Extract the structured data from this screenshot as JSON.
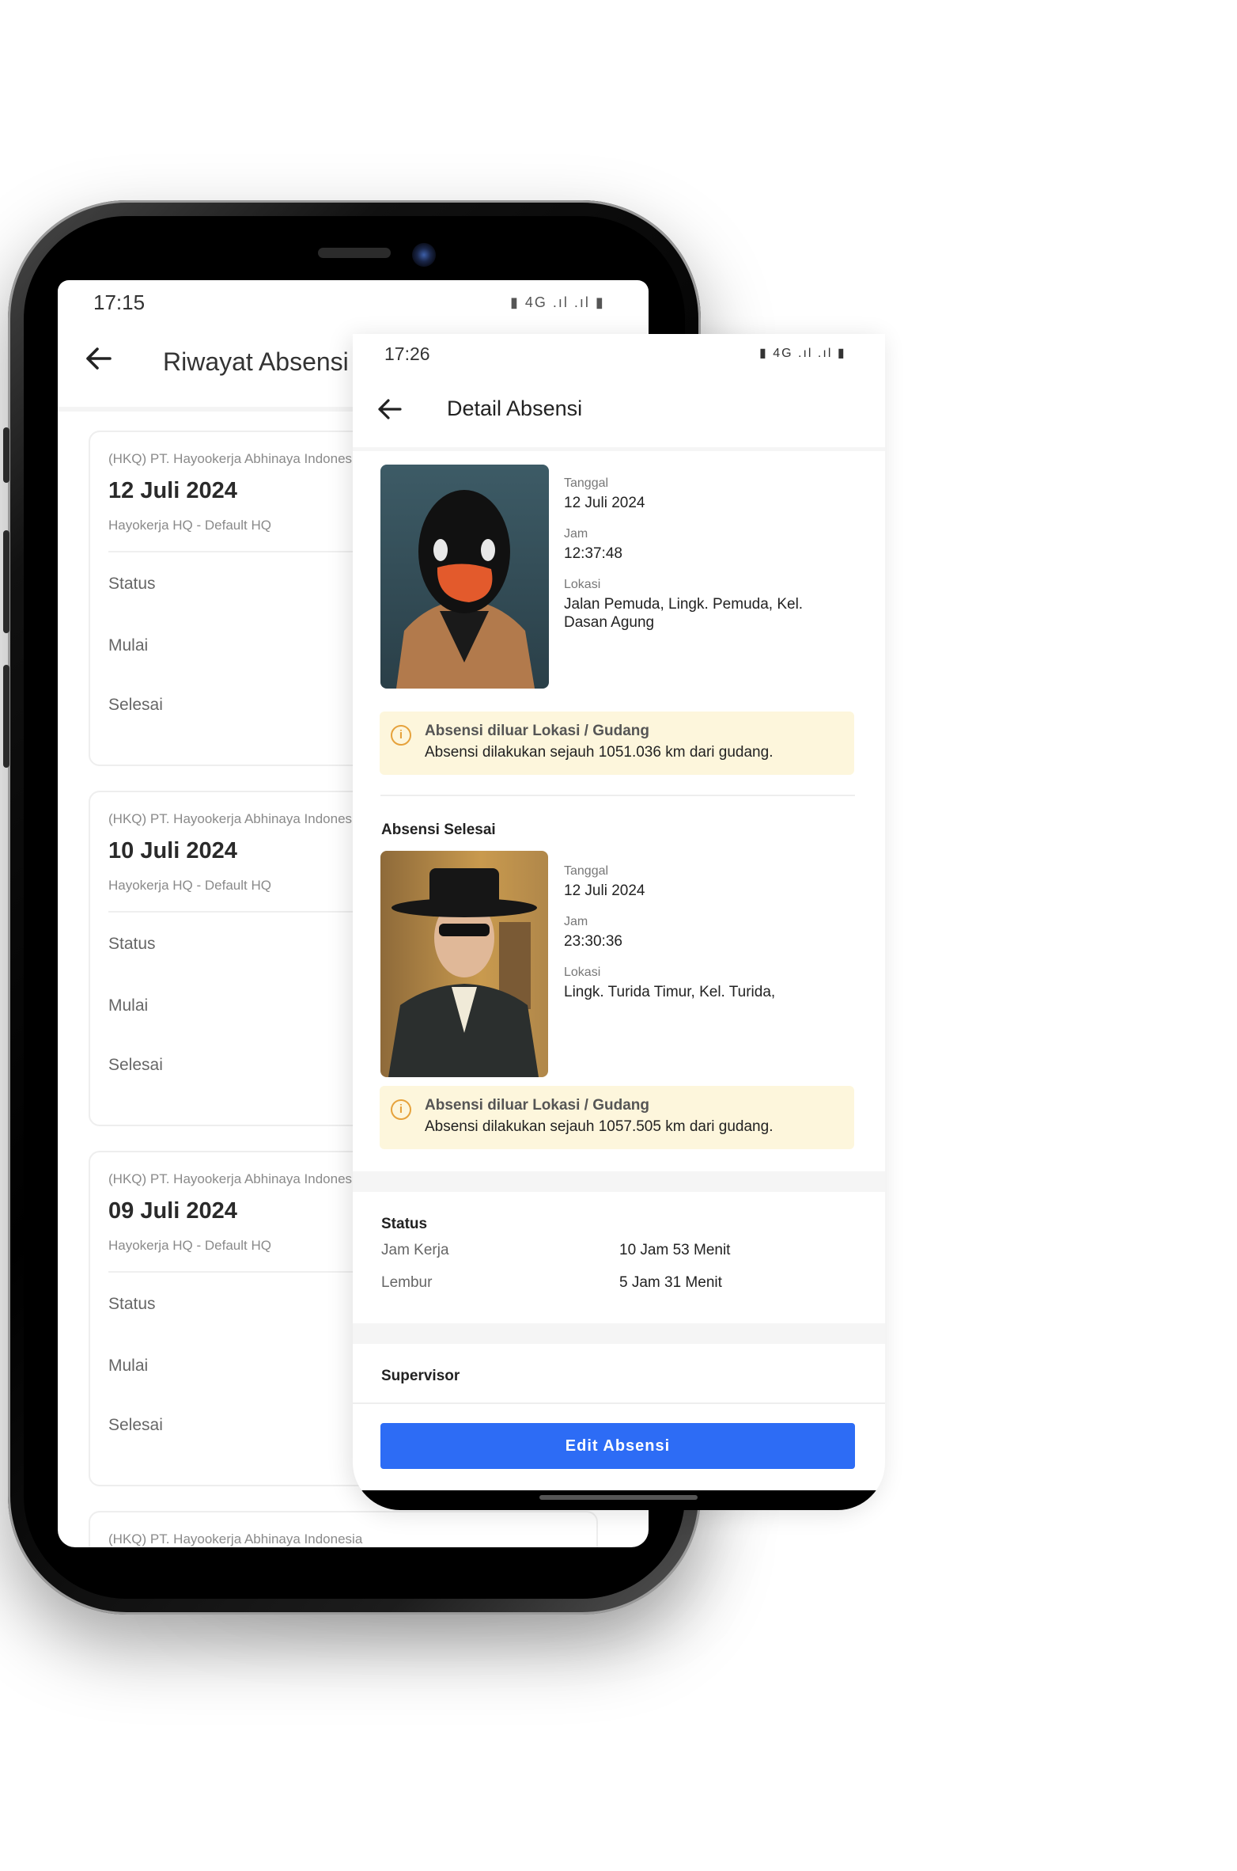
{
  "back_screen": {
    "time": "17:15",
    "status_icons": "▮ 4G .ıl .ıl ▮",
    "title": "Riwayat Absensi",
    "cards": [
      {
        "company": "(HKQ)  PT. Hayookerja Abhinaya Indonesia",
        "date": "12 Juli 2024",
        "location": "Hayokerja HQ - Default HQ",
        "status_label": "Status",
        "start_label": "Mulai",
        "end_label": "Selesai"
      },
      {
        "company": "(HKQ)  PT. Hayookerja Abhinaya Indonesia",
        "date": "10 Juli 2024",
        "location": "Hayokerja HQ - Default HQ",
        "status_label": "Status",
        "start_label": "Mulai",
        "end_label": "Selesai"
      },
      {
        "company": "(HKQ)  PT. Hayookerja Abhinaya Indonesia",
        "date": "09 Juli 2024",
        "location": "Hayokerja HQ - Default HQ",
        "status_label": "Status",
        "start_label": "Mulai",
        "end_label": "Selesai"
      },
      {
        "company": "(HKQ)  PT. Hayookerja Abhinaya Indonesia"
      }
    ]
  },
  "front_screen": {
    "time": "17:26",
    "status_icons": "▮ 4G .ıl .ıl ▮",
    "title": "Detail Absensi",
    "start_entry": {
      "date_label": "Tanggal",
      "date": "12 Juli 2024",
      "time_label": "Jam",
      "time": "12:37:48",
      "location_label": "Lokasi",
      "location": "Jalan Pemuda, Lingk. Pemuda, Kel. Dasan Agung",
      "warning_title": "Absensi diluar Lokasi / Gudang",
      "warning_text": "Absensi dilakukan sejauh 1051.036 km dari gudang."
    },
    "end_section_title": "Absensi Selesai",
    "end_entry": {
      "date_label": "Tanggal",
      "date": "12 Juli 2024",
      "time_label": "Jam",
      "time": "23:30:36",
      "location_label": "Lokasi",
      "location": "Lingk. Turida Timur, Kel. Turida,",
      "warning_title": "Absensi diluar Lokasi / Gudang",
      "warning_text": "Absensi dilakukan sejauh 1057.505 km dari gudang."
    },
    "status": {
      "title": "Status",
      "work_hours_label": "Jam Kerja",
      "work_hours": "10 Jam 53 Menit",
      "overtime_label": "Lembur",
      "overtime": "5 Jam 31 Menit"
    },
    "supervisor_title": "Supervisor",
    "edit_button": "Edit Absensi"
  },
  "colors": {
    "primary": "#2d6cf5",
    "warning_bg": "#fdf6dc",
    "warning_icon": "#e6a23c"
  },
  "icons": [
    "back-arrow-icon",
    "info-icon",
    "battery-icon",
    "signal-icon"
  ]
}
